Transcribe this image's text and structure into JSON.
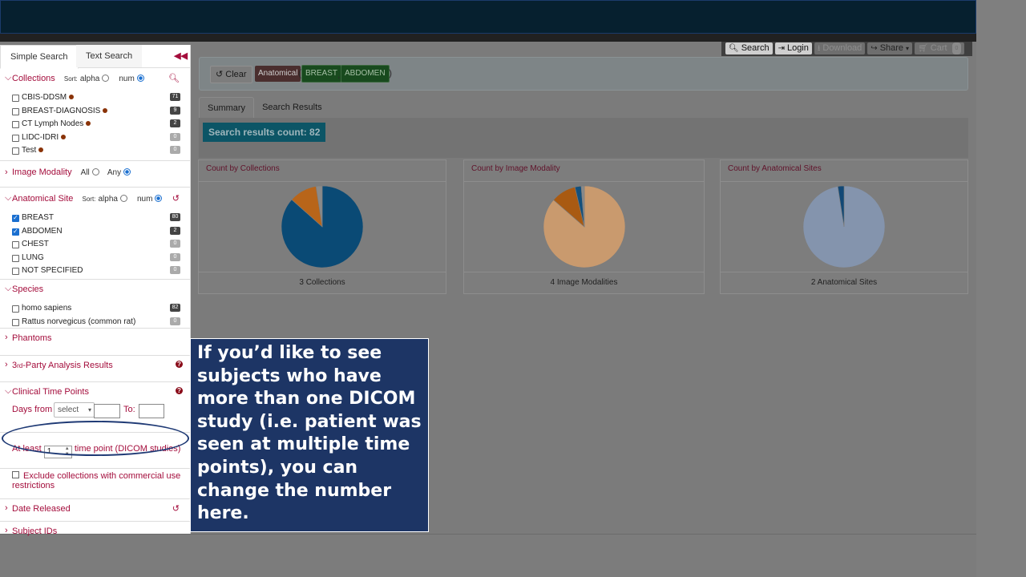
{
  "toolbar": {
    "search": "Search",
    "login": "Login",
    "download": "Download",
    "share": "Share",
    "cart": "Cart",
    "cart_count": "0"
  },
  "filterbar": {
    "clear": "Clear",
    "tag_category": "Anatomical",
    "open_paren": "(",
    "tags": [
      "BREAST",
      "ABDOMEN"
    ],
    "comma": ",",
    "close_paren": ")"
  },
  "tabs": [
    "Summary",
    "Search Results"
  ],
  "results_count": "Search results count: 82",
  "panels": [
    {
      "title": "Count by Collections",
      "footer": "3 Collections"
    },
    {
      "title": "Count by Image Modality",
      "footer": "4 Image Modalities"
    },
    {
      "title": "Count by Anatomical Sites",
      "footer": "2 Anatomical Sites"
    }
  ],
  "chart_data": [
    {
      "type": "pie",
      "title": "Count by Collections",
      "values": [
        71,
        9,
        2
      ],
      "colors": [
        "#0a4a75",
        "#b8651a",
        "#8a8a8a"
      ]
    },
    {
      "type": "pie",
      "title": "Count by Image Modality",
      "values": [
        70,
        8,
        2,
        1
      ],
      "colors": [
        "#c99a6e",
        "#a95a12",
        "#13507c",
        "#8a8a8a"
      ]
    },
    {
      "type": "pie",
      "title": "Count by Anatomical Sites",
      "values": [
        80,
        2
      ],
      "colors": [
        "#8494ad",
        "#114876"
      ]
    }
  ],
  "sidebar": {
    "tab_simple": "Simple Search",
    "tab_text": "Text Search",
    "collections": {
      "title": "Collections",
      "sort_label": "Sort:",
      "sort_alpha": "alpha",
      "sort_num": "num",
      "items": [
        {
          "label": "CBIS-DDSM",
          "count": "71"
        },
        {
          "label": "BREAST-DIAGNOSIS",
          "count": "9"
        },
        {
          "label": "CT Lymph Nodes",
          "count": "2"
        },
        {
          "label": "LIDC-IDRI",
          "count": "0"
        },
        {
          "label": "Test",
          "count": "0"
        }
      ]
    },
    "modality": {
      "title": "Image Modality",
      "all": "All",
      "any": "Any"
    },
    "anatomical": {
      "title": "Anatomical Site",
      "sort_label": "Sort:",
      "sort_alpha": "alpha",
      "sort_num": "num",
      "items": [
        {
          "label": "BREAST",
          "count": "80",
          "checked": true
        },
        {
          "label": "ABDOMEN",
          "count": "2",
          "checked": true
        },
        {
          "label": "CHEST",
          "count": "0",
          "checked": false
        },
        {
          "label": "LUNG",
          "count": "0",
          "checked": false
        },
        {
          "label": "NOT SPECIFIED",
          "count": "0",
          "checked": false
        }
      ]
    },
    "species": {
      "title": "Species",
      "items": [
        {
          "label": "homo sapiens",
          "count": "82"
        },
        {
          "label": "Rattus norvegicus (common rat)",
          "count": "0"
        }
      ]
    },
    "phantoms": "Phantoms",
    "third_party_prefix": "3",
    "third_party_sup": "rd",
    "third_party_suffix": "-Party Analysis Results",
    "clinical": {
      "title": "Clinical Time Points",
      "days_from": "Days from",
      "select": "select",
      "to": "To:",
      "at_least": "At least",
      "at_least_value": "1",
      "time_point": "time point (DICOM studies)"
    },
    "exclude": "Exclude collections with commercial use restrictions",
    "date_released": "Date Released",
    "subject_ids": "Subject IDs"
  },
  "callout": "If you’d like to see subjects who have more than one DICOM study (i.e. patient was seen at multiple time points), you can change the number here."
}
